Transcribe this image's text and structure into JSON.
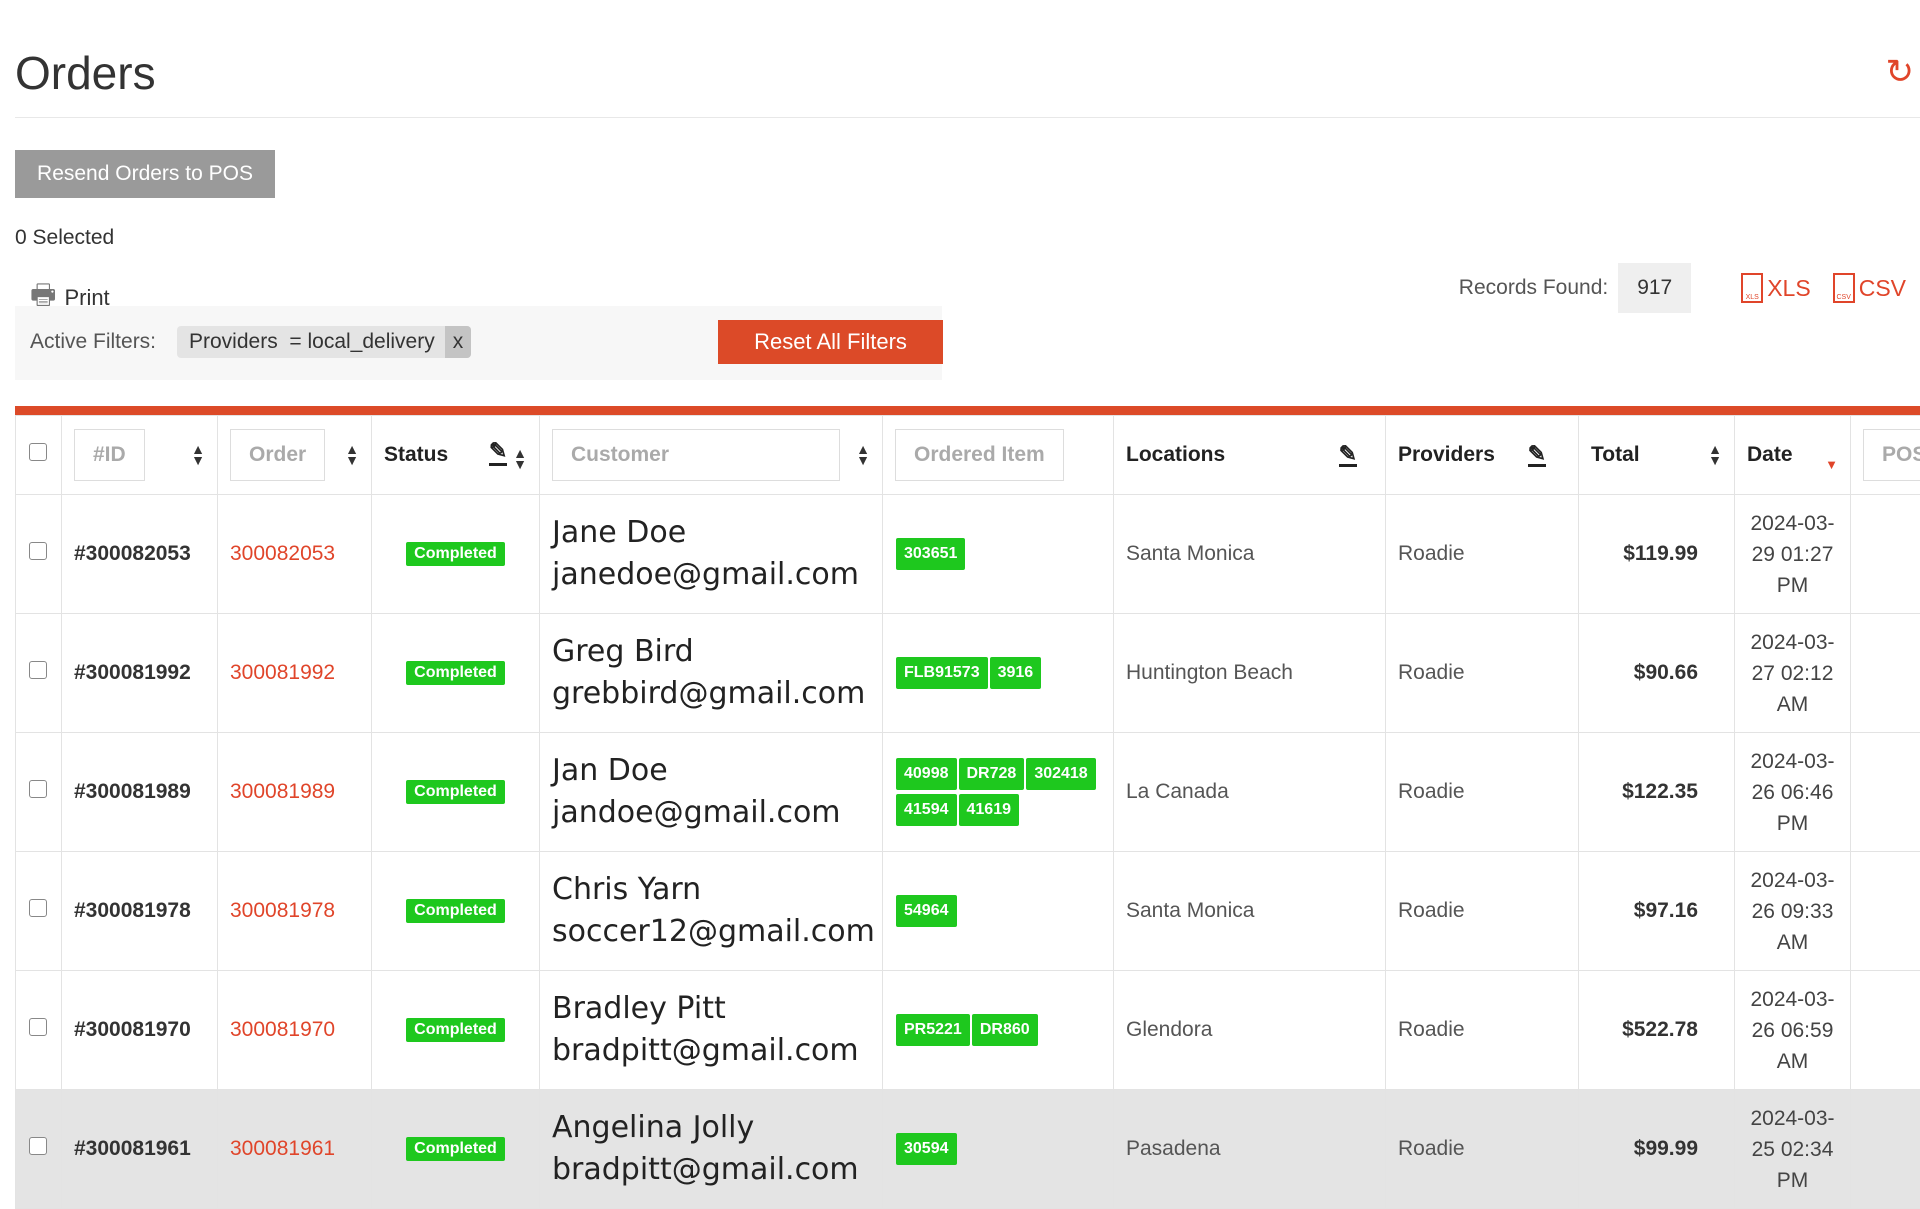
{
  "page": {
    "title": "Orders",
    "refresh_icon": "refresh-icon"
  },
  "toolbar": {
    "resend_label": "Resend Orders to POS",
    "selected": "0 Selected",
    "print_label": "Print"
  },
  "filters": {
    "label": "Active Filters:",
    "chip_field": "Providers",
    "chip_value": "= local_delivery",
    "chip_remove": "x",
    "reset_label": "Reset All Filters"
  },
  "records": {
    "label": "Records Found:",
    "count": "917",
    "xls": "XLS",
    "csv": "CSV"
  },
  "colors": {
    "accent": "#dc4a28",
    "badge": "#1ec81e"
  },
  "table": {
    "headers": {
      "id": "#ID",
      "order": "Order",
      "status": "Status",
      "customer": "Customer",
      "item": "Ordered Item",
      "locations": "Locations",
      "providers": "Providers",
      "total": "Total",
      "date": "Date",
      "pos": "POS"
    },
    "rows": [
      {
        "id": "#300082053",
        "order": "300082053",
        "status": "Completed",
        "name": "Jane Doe",
        "email": "janedoe@gmail.com",
        "items": [
          "303651"
        ],
        "location": "Santa Monica",
        "provider": "Roadie",
        "total": "$119.99",
        "date": "2024-03-29 01:27 PM"
      },
      {
        "id": "#300081992",
        "order": "300081992",
        "status": "Completed",
        "name": "Greg Bird",
        "email": "grebbird@gmail.com",
        "items": [
          "FLB91573",
          "3916"
        ],
        "location": "Huntington Beach",
        "provider": "Roadie",
        "total": "$90.66",
        "date": "2024-03-27 02:12 AM"
      },
      {
        "id": "#300081989",
        "order": "300081989",
        "status": "Completed",
        "name": "Jan Doe",
        "email": "jandoe@gmail.com",
        "items": [
          "40998",
          "DR728",
          "302418",
          "41594",
          "41619"
        ],
        "location": "La Canada",
        "provider": "Roadie",
        "total": "$122.35",
        "date": "2024-03-26 06:46 PM"
      },
      {
        "id": "#300081978",
        "order": "300081978",
        "status": "Completed",
        "name": "Chris Yarn",
        "email": "soccer12@gmail.com",
        "items": [
          "54964"
        ],
        "location": "Santa Monica",
        "provider": "Roadie",
        "total": "$97.16",
        "date": "2024-03-26 09:33 AM"
      },
      {
        "id": "#300081970",
        "order": "300081970",
        "status": "Completed",
        "name": "Bradley Pitt",
        "email": "bradpitt@gmail.com",
        "items": [
          "PR5221",
          "DR860"
        ],
        "location": "Glendora",
        "provider": "Roadie",
        "total": "$522.78",
        "date": "2024-03-26 06:59 AM"
      },
      {
        "id": "#300081961",
        "order": "300081961",
        "status": "Completed",
        "name": "Angelina Jolly",
        "email": "bradpitt@gmail.com",
        "items": [
          "30594"
        ],
        "location": "Pasadena",
        "provider": "Roadie",
        "total": "$99.99",
        "date": "2024-03-25 02:34 PM"
      }
    ]
  }
}
